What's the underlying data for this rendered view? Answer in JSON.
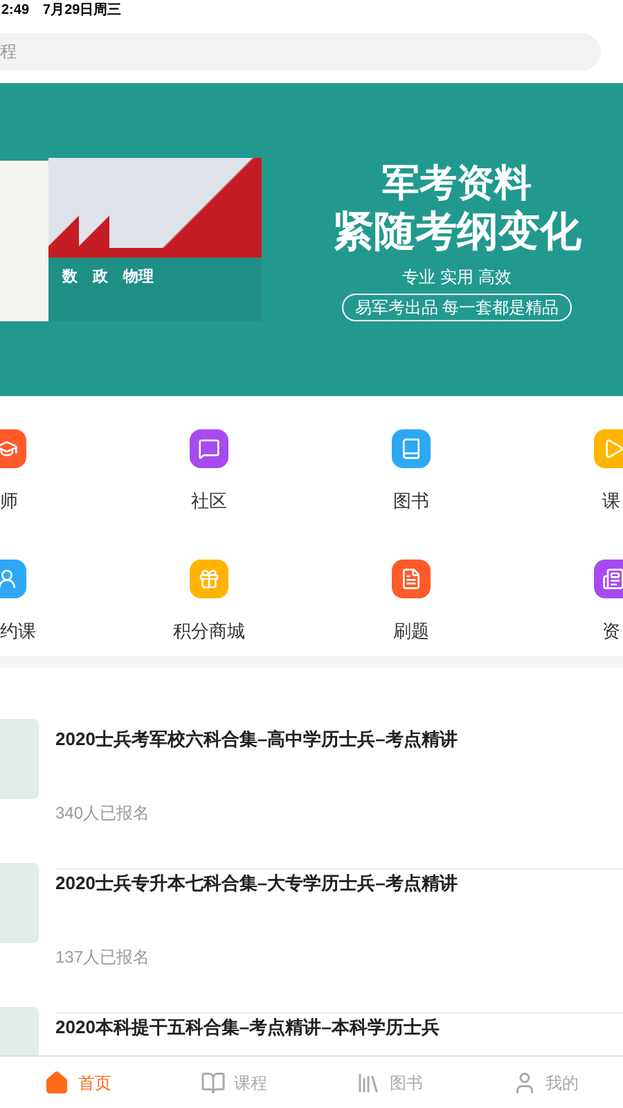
{
  "status_bar": {
    "time": "2:49",
    "date": "7月29日周三"
  },
  "search": {
    "placeholder": "程"
  },
  "banner": {
    "headline": "军考资料",
    "subheadline": "紧随考纲变化",
    "slogan": "专业 实用 高效",
    "tagline": "易军考出品 每一套都是精品",
    "books": [
      "数",
      "政",
      "物理"
    ]
  },
  "shortcuts": [
    {
      "label": "师",
      "color": "#ff5a2a"
    },
    {
      "label": "社区",
      "color": "#a64bf0"
    },
    {
      "label": "图书",
      "color": "#2ea8f5"
    },
    {
      "label": "课",
      "color": "#ffb400"
    },
    {
      "label": "约课",
      "color": "#2ea8f5"
    },
    {
      "label": "积分商城",
      "color": "#ffb400"
    },
    {
      "label": "刷题",
      "color": "#ff5a2a"
    },
    {
      "label": "资",
      "color": "#a64bf0"
    }
  ],
  "courses": [
    {
      "title": "2020士兵考军校六科合集–高中学历士兵–考点精讲",
      "enrolled": "340人已报名"
    },
    {
      "title": "2020士兵专升本七科合集–大专学历士兵–考点精讲",
      "enrolled": "137人已报名"
    },
    {
      "title": "2020本科提干五科合集–考点精讲–本科学历士兵"
    }
  ],
  "tab_bar": [
    {
      "label": "首页",
      "selected": true
    },
    {
      "label": "课程",
      "selected": false
    },
    {
      "label": "图书",
      "selected": false
    },
    {
      "label": "我的",
      "selected": false
    }
  ]
}
